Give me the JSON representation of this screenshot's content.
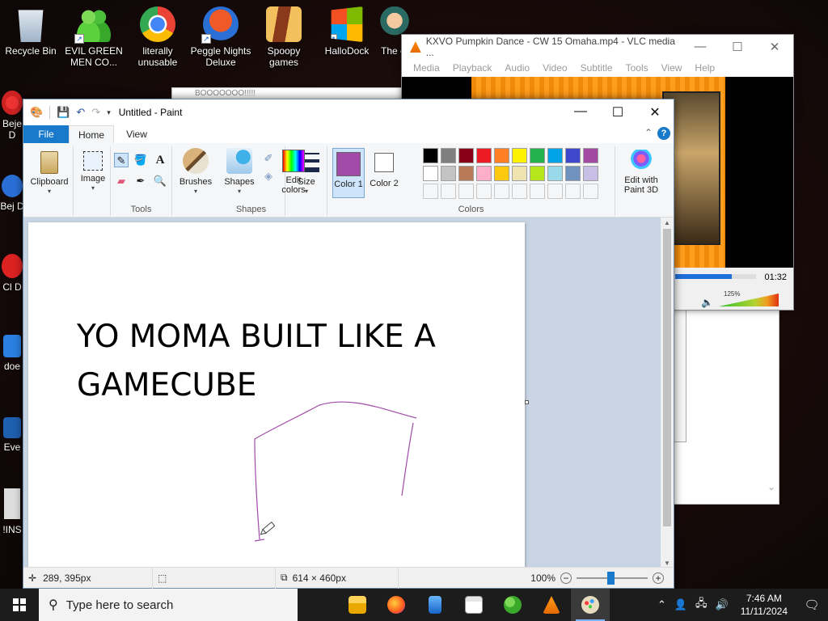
{
  "desktop": {
    "icons": [
      {
        "label": "Recycle Bin",
        "icon": "recycle-bin-icon"
      },
      {
        "label": "EVIL GREEN MEN CO...",
        "icon": "messenger-men-icon"
      },
      {
        "label": "literally unusable",
        "icon": "chrome-icon"
      },
      {
        "label": "Peggle Nights Deluxe",
        "icon": "peggle-icon"
      },
      {
        "label": "Spoopy games",
        "icon": "folder-icon"
      },
      {
        "label": "HalloDock",
        "icon": "windows-logo-icon"
      },
      {
        "label": "The of",
        "icon": "character-icon"
      }
    ],
    "left_labels": [
      "Beje D",
      "Bej D",
      "Cl D",
      "doe",
      "Eve",
      "!INS"
    ]
  },
  "vlc": {
    "title": "KXVO Pumpkin Dance - CW 15 Omaha.mp4 - VLC media ...",
    "menu": [
      "Media",
      "Playback",
      "Audio",
      "Video",
      "Subtitle",
      "Tools",
      "View",
      "Help"
    ],
    "time": "01:32",
    "volume": "125%",
    "seek_progress": 0.7
  },
  "behind_window": {
    "title": "BOOOOOOO!!!!!"
  },
  "paint": {
    "title": "Untitled - Paint",
    "tabs": {
      "file": "File",
      "home": "Home",
      "view": "View"
    },
    "ribbon": {
      "clipboard": "Clipboard",
      "image": "Image",
      "tools_group": "Tools",
      "brushes": "Brushes",
      "shapes": "Shapes",
      "shapes_group": "Shapes",
      "size": "Size",
      "color1": "Color 1",
      "color2": "Color 2",
      "colors_group": "Colors",
      "edit_colors": "Edit colors",
      "edit_with_3d": "Edit with Paint 3D"
    },
    "colors": {
      "color1": "#a14aa8",
      "color2": "#ffffff",
      "row1": [
        "#000000",
        "#7f7f7f",
        "#880015",
        "#ed1c24",
        "#ff7f27",
        "#fff200",
        "#22b14c",
        "#00a2e8",
        "#3f48cc",
        "#a349a4"
      ],
      "row2": [
        "#ffffff",
        "#c3c3c3",
        "#b97a57",
        "#ffaec9",
        "#ffc90e",
        "#efe4b0",
        "#b5e61d",
        "#99d9ea",
        "#7092be",
        "#c8bfe7"
      ]
    },
    "canvas": {
      "line1": "YO MOMA BUILT LIKE A",
      "line2": "GAMECUBE",
      "stroke_color": "#a14aa8"
    },
    "status": {
      "cursor": "289, 395px",
      "canvas_size": "614 × 460px",
      "zoom": "100%"
    }
  },
  "taskbar": {
    "search_placeholder": "Type here to search",
    "time": "7:46 AM",
    "date": "11/11/2024"
  }
}
